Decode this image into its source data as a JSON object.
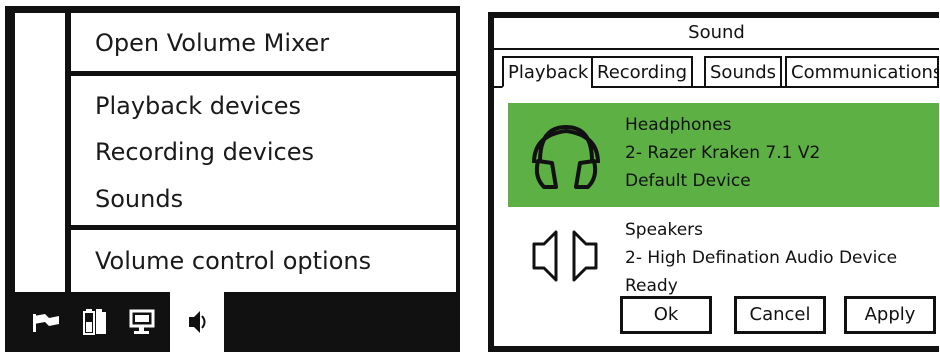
{
  "context_menu": {
    "items": [
      {
        "label": "Open Volume Mixer"
      },
      {
        "label": "Playback devices"
      },
      {
        "label": "Recording devices"
      },
      {
        "label": "Sounds"
      },
      {
        "label": "Volume control options"
      }
    ]
  },
  "taskbar": {
    "tray_icons": [
      "flag-icon",
      "battery-icon",
      "network-monitor-icon",
      "speaker-icon"
    ],
    "active_icon": "speaker-icon"
  },
  "sound_dialog": {
    "title": "Sound",
    "tabs": [
      {
        "label": "Playback",
        "active": true
      },
      {
        "label": "Recording",
        "active": false
      },
      {
        "label": "Sounds",
        "active": false
      },
      {
        "label": "Communications",
        "active": false
      }
    ],
    "devices": [
      {
        "icon": "headphones-icon",
        "name": "Headphones",
        "description": "2- Razer Kraken 7.1 V2",
        "status": "Default Device",
        "selected": true
      },
      {
        "icon": "speakers-icon",
        "name": "Speakers",
        "description": "2- High Defination Audio Device",
        "status": "Ready",
        "selected": false
      }
    ],
    "buttons": {
      "ok": "Ok",
      "cancel": "Cancel",
      "apply": "Apply"
    }
  },
  "colors": {
    "selection": "#5cb044",
    "frame": "#111111"
  }
}
